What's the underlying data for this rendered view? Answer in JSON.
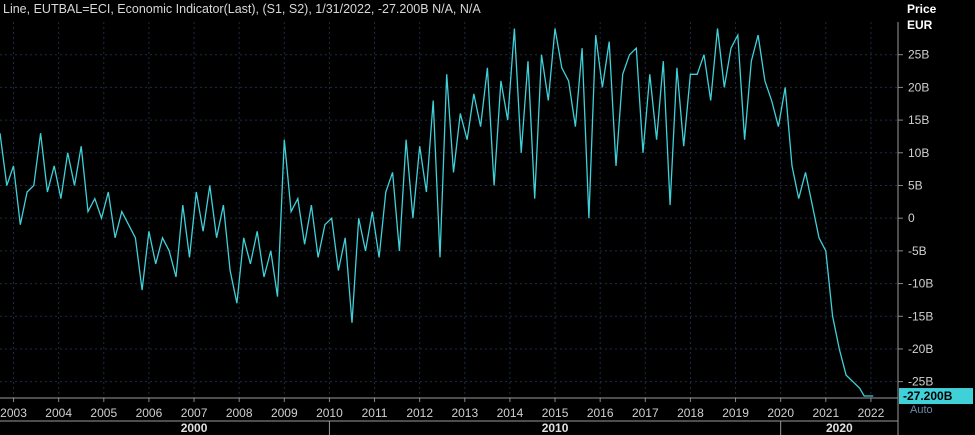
{
  "header": {
    "line": "Line, EUTBAL=ECI, Economic Indicator(Last), (S1, S2)",
    "date": "1/31/2022",
    "value": "-27.200B",
    "na": "N/A, N/A"
  },
  "axis": {
    "price_label": "Price",
    "currency": "EUR"
  },
  "last_value_tag": "-27.200B",
  "auto_label": "Auto",
  "colors": {
    "line": "#3fd0d8",
    "tag_bg": "#3fd0d8",
    "grid": "#1c2c44",
    "background": "#000000"
  },
  "chart_data": {
    "type": "line",
    "title": "",
    "ylim": [
      -27.5,
      30
    ],
    "xlim": [
      2002.7,
      2022.6
    ],
    "y_ticks": [
      25,
      20,
      15,
      10,
      5,
      0,
      -5,
      -10,
      -15,
      -20,
      -25
    ],
    "y_tick_labels": [
      "25B",
      "20B",
      "15B",
      "10B",
      "5B",
      "0",
      "-5B",
      "-10B",
      "-15B",
      "-20B",
      "-25B"
    ],
    "x_ticks": [
      2003,
      2004,
      2005,
      2006,
      2007,
      2008,
      2009,
      2010,
      2011,
      2012,
      2013,
      2014,
      2015,
      2016,
      2017,
      2018,
      2019,
      2020,
      2021,
      2022
    ],
    "decades": [
      {
        "label": "2000",
        "x": 2007.0
      },
      {
        "label": "2010",
        "x": 2015.0
      },
      {
        "label": "2020",
        "x": 2021.3
      }
    ],
    "series": [
      {
        "x": [
          2002.7,
          2002.85,
          2003.0,
          2003.15,
          2003.3,
          2003.45,
          2003.6,
          2003.75,
          2003.9,
          2004.05,
          2004.2,
          2004.35,
          2004.5,
          2004.65,
          2004.8,
          2004.95,
          2005.1,
          2005.25,
          2005.4,
          2005.55,
          2005.7,
          2005.85,
          2006.0,
          2006.15,
          2006.3,
          2006.45,
          2006.6,
          2006.75,
          2006.9,
          2007.05,
          2007.2,
          2007.35,
          2007.5,
          2007.65,
          2007.8,
          2007.95,
          2008.1,
          2008.25,
          2008.4,
          2008.55,
          2008.7,
          2008.85,
          2009.0,
          2009.15,
          2009.3,
          2009.45,
          2009.6,
          2009.75,
          2009.9,
          2010.05,
          2010.2,
          2010.35,
          2010.5,
          2010.65,
          2010.8,
          2010.95,
          2011.1,
          2011.25,
          2011.4,
          2011.55,
          2011.7,
          2011.85,
          2012.0,
          2012.15,
          2012.3,
          2012.45,
          2012.6,
          2012.75,
          2012.9,
          2013.05,
          2013.2,
          2013.35,
          2013.5,
          2013.65,
          2013.8,
          2013.95,
          2014.1,
          2014.25,
          2014.4,
          2014.55,
          2014.7,
          2014.85,
          2015.0,
          2015.15,
          2015.3,
          2015.45,
          2015.6,
          2015.75,
          2015.9,
          2016.05,
          2016.2,
          2016.35,
          2016.5,
          2016.65,
          2016.8,
          2016.95,
          2017.1,
          2017.25,
          2017.4,
          2017.55,
          2017.7,
          2017.85,
          2018.0,
          2018.15,
          2018.3,
          2018.45,
          2018.6,
          2018.75,
          2018.9,
          2019.05,
          2019.2,
          2019.35,
          2019.5,
          2019.65,
          2019.8,
          2019.95,
          2020.1,
          2020.25,
          2020.4,
          2020.55,
          2020.7,
          2020.85,
          2021.0,
          2021.15,
          2021.3,
          2021.45,
          2021.6,
          2021.75,
          2021.85,
          2021.95,
          2022.05
        ],
        "y": [
          13,
          5,
          8,
          -1,
          4,
          5,
          13,
          4,
          8,
          3,
          10,
          5,
          11,
          1,
          3,
          0,
          4,
          -3,
          1,
          -1,
          -3,
          -11,
          -2,
          -7,
          -3,
          -5,
          -9,
          2,
          -6,
          4,
          -2,
          5,
          -3,
          2,
          -8,
          -13,
          -3,
          -7,
          -2,
          -9,
          -5,
          -12,
          12,
          1,
          3,
          -4,
          2,
          -6,
          -1,
          0,
          -8,
          -3,
          -16,
          0,
          -5,
          1,
          -6,
          4,
          7,
          -5,
          12,
          0,
          11,
          4,
          18,
          -6,
          22,
          7,
          16,
          12,
          19,
          14,
          23,
          5,
          21,
          15,
          29,
          10,
          24,
          3,
          25,
          18,
          29,
          23,
          21,
          14,
          26,
          0,
          28,
          20,
          27,
          8,
          22,
          25,
          26,
          10,
          22,
          12,
          24,
          2,
          23,
          11,
          22,
          22,
          25,
          18,
          29,
          20,
          26,
          28,
          12,
          24,
          28,
          21,
          18,
          14,
          20,
          8,
          3,
          7,
          2,
          -3,
          -5,
          -15,
          -20,
          -24,
          -25,
          -26,
          -27.2,
          -27.2,
          -27.2
        ]
      }
    ]
  }
}
